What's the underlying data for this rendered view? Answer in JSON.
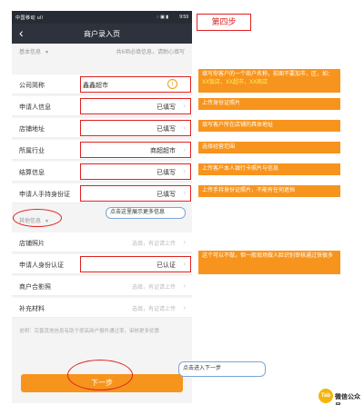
{
  "status_bar": {
    "signal": "中国移动 ull",
    "icons": "◌ ▣ ▮",
    "time": "9:59"
  },
  "nav": {
    "back_icon": "chevron-left",
    "title": "商户录入页"
  },
  "basic_section": {
    "label": "基本信息",
    "note": "共6项必填信息，请耐心填写"
  },
  "rows_basic": [
    {
      "label": "公司简称",
      "value": "鑫鑫超市",
      "trailing": "info-icon"
    },
    {
      "label": "申请人信息",
      "value": "已填写"
    },
    {
      "label": "店铺地址",
      "value": "已填写"
    },
    {
      "label": "所属行业",
      "value": "商超超市"
    },
    {
      "label": "结算信息",
      "value": "已填写"
    },
    {
      "label": "申请人手持身份证",
      "value": "已填写"
    }
  ],
  "other_section": {
    "label": "其他信息"
  },
  "rows_other": [
    {
      "label": "店铺照片",
      "value": "选填，有证请上传"
    },
    {
      "label": "申请人身份认证",
      "value": "已认证"
    },
    {
      "label": "商户合影照",
      "value": "选填，有证请上传"
    },
    {
      "label": "补充材料",
      "value": "选填，有证请上传"
    }
  ],
  "description": "说明：完善其他信息有助于提高商户报件通过率，审核更多优惠",
  "next_button": "下一步",
  "annotations": {
    "step": "第四步",
    "company_note_parts": [
      "填写你客户的一个商户名称，前面不要加市，区，如：",
      "XX饭店，XX超市，XX商店"
    ],
    "applicant_note": "上传身份证照片",
    "address_note": "填写客户所在店铺的具体地址",
    "industry_note": "选择经营范围",
    "settlement_note": "上传客户本人银行卡照片与信息",
    "handheld_note": "上传手持身份证照片，不能有任何遮挡",
    "more_note": "点击这里展示更多信息",
    "auth_note": "这个可以不做，但一般现场做人脸识别审核通过快很多",
    "next_note": "点击进入下一步"
  },
  "logo": {
    "mark": "Tab",
    "text": "微信公众号"
  },
  "colors": {
    "accent_orange": "#f7941d",
    "nav_dark": "#2d323c",
    "annotation_red": "#e02020",
    "highlight_yellow": "#fff35c",
    "blue_border": "#7aa7d8"
  }
}
